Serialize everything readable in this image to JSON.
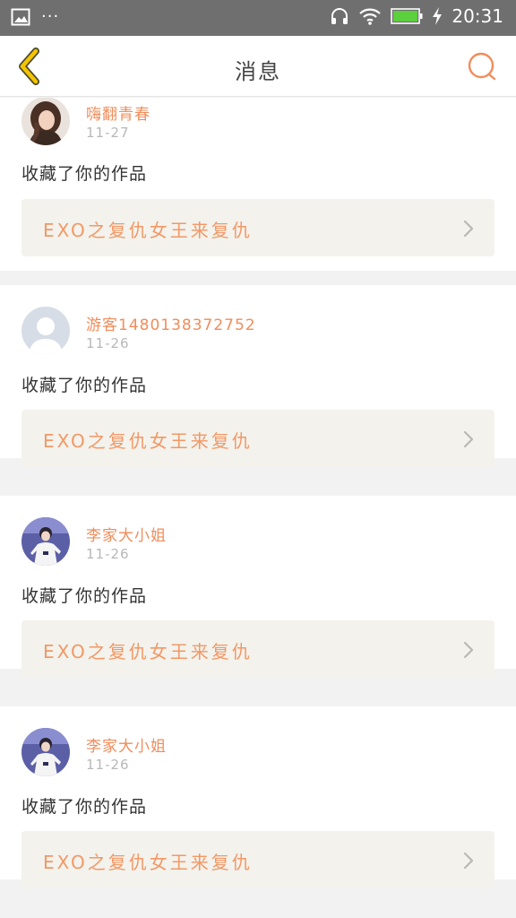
{
  "statusbar": {
    "time": "20:31",
    "dots": "···"
  },
  "header": {
    "title": "消息"
  },
  "messages": [
    {
      "username": "嗨翻青春",
      "date": "11-27",
      "action": "收藏了你的作品",
      "work_title": "EXO之复仇女王来复仇",
      "avatar": "avatar-photo-girl"
    },
    {
      "username": "游客1480138372752",
      "date": "11-26",
      "action": "收藏了你的作品",
      "work_title": "EXO之复仇女王来复仇",
      "avatar": "avatar-default-user"
    },
    {
      "username": "李家大小姐",
      "date": "11-26",
      "action": "收藏了你的作品",
      "work_title": "EXO之复仇女王来复仇",
      "avatar": "avatar-photo-stage"
    },
    {
      "username": "李家大小姐",
      "date": "11-26",
      "action": "收藏了你的作品",
      "work_title": "EXO之复仇女王来复仇",
      "avatar": "avatar-photo-stage"
    }
  ],
  "colors": {
    "accent": "#f28c5a",
    "back_arrow": "#f5c400",
    "work_bg": "#f3f2ec"
  }
}
